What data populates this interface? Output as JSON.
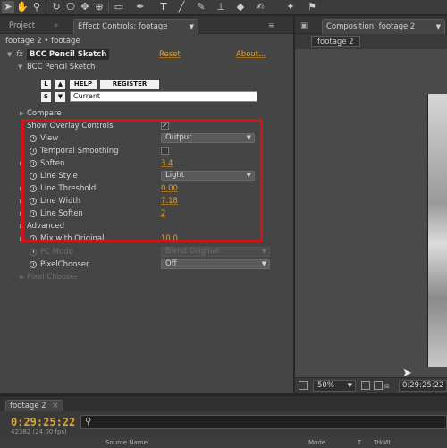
{
  "toolbar": {
    "tools": [
      "selection-tool",
      "hand-tool",
      "zoom-tool",
      "rotate-tool",
      "camera-tool",
      "pan-behind-tool",
      "rectangle-tool",
      "pen-tool",
      "type-tool",
      "brush-tool",
      "clone-stamp-tool",
      "eraser-tool",
      "roto-brush-tool",
      "puppet-tool"
    ],
    "type_glyph": "T"
  },
  "left_panel": {
    "tab_project": "Project",
    "tab_effect_controls": "Effect Controls: footage",
    "subtitle": "footage 2 • footage",
    "effect": {
      "fx": "fx",
      "name": "BCC Pencil Sketch",
      "reset": "Reset",
      "about": "About...",
      "subname": "BCC Pencil Sketch",
      "btn_L": "L",
      "btn_up": "▲",
      "btn_help": "HELP",
      "btn_register": "REGISTER",
      "btn_S": "S",
      "btn_down": "▼",
      "preset_value": "Current"
    },
    "params": {
      "compare": "Compare",
      "show_overlay": "Show Overlay Controls",
      "view": "View",
      "view_value": "Output",
      "temporal_smoothing": "Temporal Smoothing",
      "soften": "Soften",
      "soften_value": "3.4",
      "line_style": "Line Style",
      "line_style_value": "Light",
      "line_threshold": "Line Threshold",
      "line_threshold_value": "0.00",
      "line_width": "Line Width",
      "line_width_value": "7.18",
      "line_soften": "Line Soften",
      "line_soften_value": "2",
      "advanced": "Advanced",
      "mix_with_original": "Mix with Original",
      "mix_value": "10.0",
      "pc_mode": "PC Mode",
      "pc_mode_value": "Blend Original",
      "pixel_chooser": "PixelChooser",
      "pixel_chooser_value": "Off",
      "pixel_chooser_group": "Pixel Chooser"
    },
    "highlight_color": "#d0141a"
  },
  "right_panel": {
    "tab_composition": "Composition: footage 2",
    "comp_label": "footage 2",
    "zoom": "50%",
    "timecode": "0:29:25:22"
  },
  "timeline": {
    "tab": "footage 2",
    "timecode": "0:29:25:22",
    "frames": "42382 (24.00 fps)",
    "search_placeholder": "",
    "col_source_name": "Source Name",
    "col_mode": "Mode",
    "col_t": "T",
    "col_trkmat": "TrkMt"
  },
  "colors": {
    "accent_orange": "#e0a030",
    "panel_bg": "#454545"
  }
}
